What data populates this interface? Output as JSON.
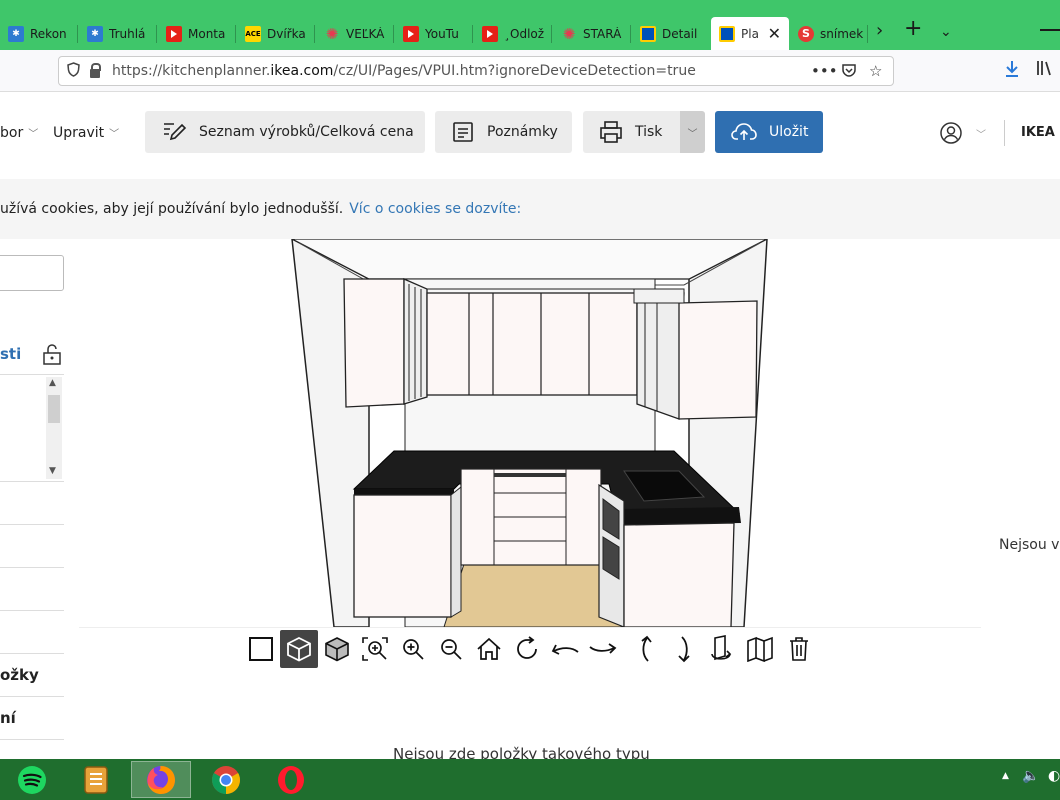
{
  "browser": {
    "tabs": [
      {
        "label": "Rekon",
        "icon": "bug-icon"
      },
      {
        "label": "Truhlá",
        "icon": "bug-icon"
      },
      {
        "label": "Monta",
        "icon": "youtube-icon"
      },
      {
        "label": "Dvířka",
        "icon": "ace-icon"
      },
      {
        "label": "VEĽKÁ",
        "icon": "sun-icon"
      },
      {
        "label": "YouTu",
        "icon": "youtube-icon"
      },
      {
        "label": "¸Odlož",
        "icon": "youtube-icon"
      },
      {
        "label": "STARÁ",
        "icon": "sun-icon"
      },
      {
        "label": "Detail",
        "icon": "ikea-icon"
      },
      {
        "label": "Pla",
        "icon": "ikea-icon",
        "active": true
      },
      {
        "label": "snímek",
        "icon": "s-icon"
      }
    ],
    "url": "https://kitchenplanner.ikea.com/cz/UI/Pages/VPUI.htm?ignoreDeviceDetection=true",
    "url_parts": {
      "pre": "https://kitchenplanner.",
      "host": "ikea.com",
      "post": "/cz/UI/Pages/VPUI.htm?ignoreDeviceDetection=true"
    },
    "tab_strip_color": "#3fc66a"
  },
  "toolbar": {
    "menu_partial": "bor",
    "menu_edit": "Upravit",
    "product_list_label": "Seznam výrobků/Celková cena",
    "notes_label": "Poznámky",
    "print_label": "Tisk",
    "save_label": "Uložit",
    "brand_partial": "IKEA C",
    "save_color": "#2f6fb1"
  },
  "cookie": {
    "text": "užívá cookies, aby její používání bylo jednodušší.",
    "link": "Víc o cookies se dozvíte:"
  },
  "left_panel": {
    "label_partial": "sti",
    "rows": [
      "",
      "",
      "",
      "",
      "ožky",
      "ní"
    ]
  },
  "viewer": {
    "items_message": "Nejsou zde položky takového typu",
    "right_message": "Nejsou v",
    "tools": [
      "2d-view-icon",
      "3d-view-icon",
      "3d-wireframe-icon",
      "zoom-area-icon",
      "zoom-in-icon",
      "zoom-out-icon",
      "home-view-icon",
      "rotate-icon",
      "pan-left-icon",
      "pan-right-icon",
      "tilt-up-icon",
      "tilt-down-icon",
      "walls-icon",
      "open-walls-icon",
      "delete-icon"
    ],
    "selected_tool": "3d-view-icon"
  },
  "taskbar": {
    "apps": [
      "spotify-icon",
      "notes-app-icon",
      "firefox-icon",
      "chrome-icon",
      "opera-icon"
    ],
    "active_app": "firefox-icon"
  }
}
